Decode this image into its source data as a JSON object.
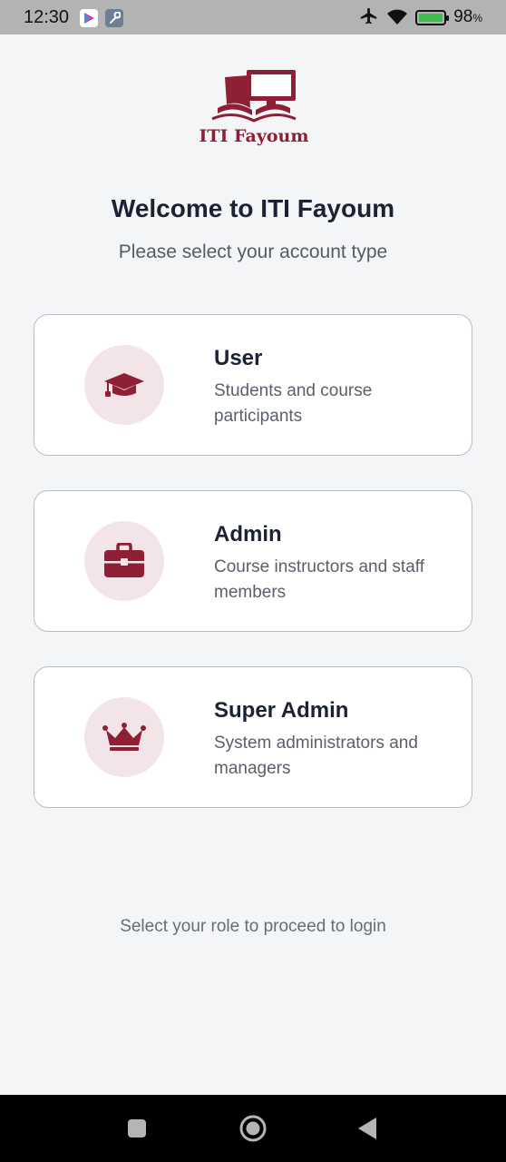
{
  "status_bar": {
    "time": "12:30",
    "battery_percent": "98",
    "battery_unit": "%",
    "icons": [
      "play-store-icon",
      "wrench-icon",
      "airplane-icon",
      "wifi-icon",
      "battery-icon"
    ]
  },
  "logo": {
    "text": "ITI Fayoum"
  },
  "welcome": {
    "title": "Welcome to ITI Fayoum",
    "subtitle": "Please select your account type"
  },
  "roles": [
    {
      "title": "User",
      "description": "Students and course participants",
      "icon": "graduation-cap-icon"
    },
    {
      "title": "Admin",
      "description": "Course instructors and staff members",
      "icon": "briefcase-icon"
    },
    {
      "title": "Super Admin",
      "description": "System administrators and managers",
      "icon": "crown-icon"
    }
  ],
  "footer": {
    "hint": "Select your role to proceed to login"
  },
  "colors": {
    "brand": "#8e1f35",
    "icon_bg": "#f3e4e7",
    "background": "#f4f5f7"
  },
  "nav_bar": {
    "buttons": [
      "recents-button",
      "home-button",
      "back-button"
    ]
  }
}
